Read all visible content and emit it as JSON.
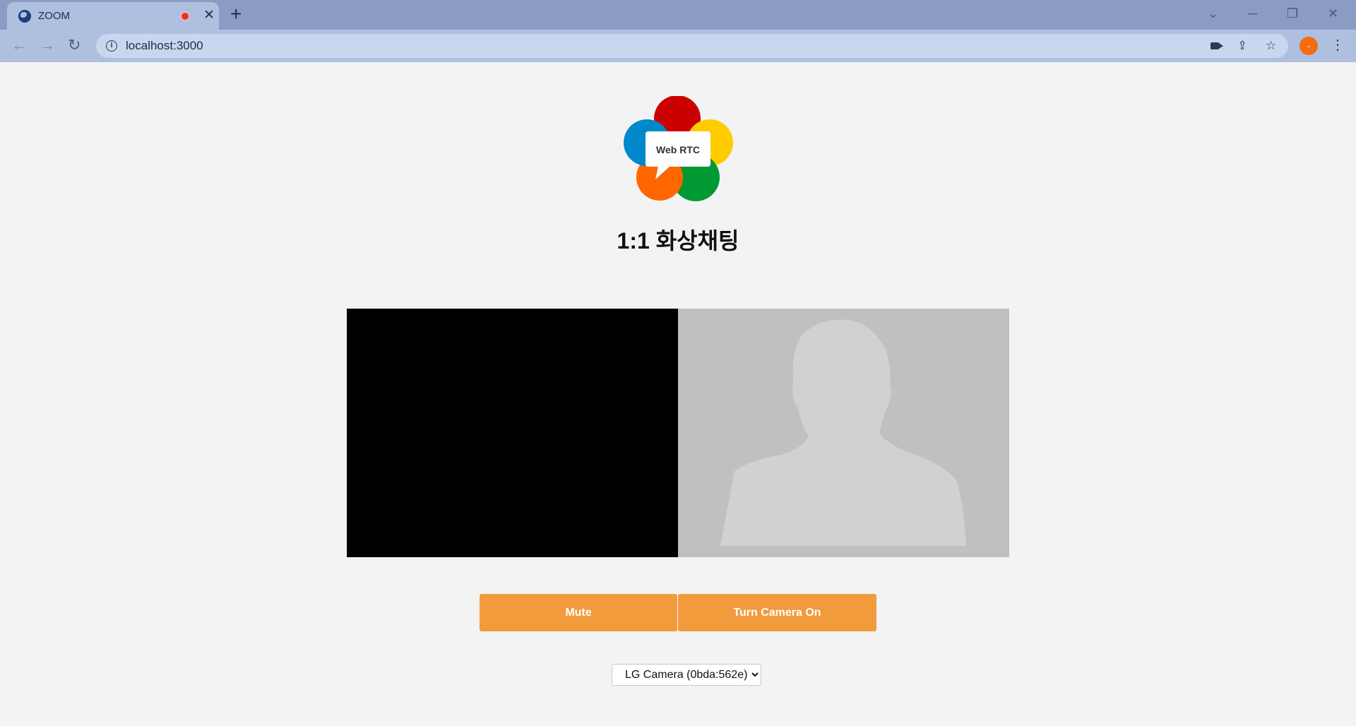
{
  "browser": {
    "tab_title": "ZOOM",
    "url": "localhost:3000",
    "avatar_initial": "-"
  },
  "page": {
    "logo_text": "Web RTC",
    "title": "1:1 화상채팅",
    "mute_label": "Mute",
    "camera_label": "Turn Camera On",
    "camera_select_value": "LG Camera (0bda:562e)"
  }
}
